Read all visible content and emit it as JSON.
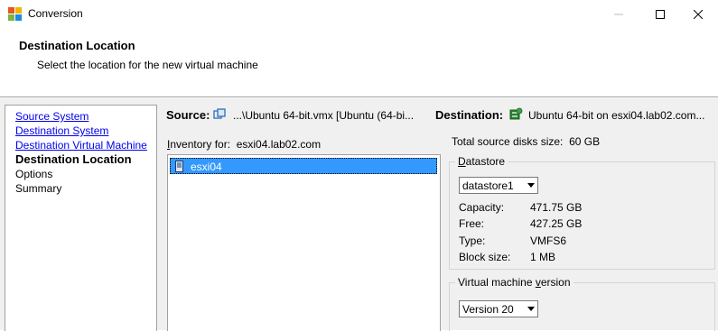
{
  "window": {
    "title": "Conversion"
  },
  "header": {
    "title": "Destination Location",
    "subtitle": "Select the location for the new virtual machine"
  },
  "nav": {
    "items": [
      {
        "label": "Source System",
        "state": "link"
      },
      {
        "label": "Destination System",
        "state": "link"
      },
      {
        "label": "Destination Virtual Machine",
        "state": "link"
      },
      {
        "label": "Destination Location",
        "state": "current"
      },
      {
        "label": "Options",
        "state": "plain"
      },
      {
        "label": "Summary",
        "state": "plain"
      }
    ]
  },
  "source": {
    "label": "Source:",
    "value": "...\\Ubuntu 64-bit.vmx [Ubuntu (64-bi..."
  },
  "destination": {
    "label": "Destination:",
    "value": "Ubuntu 64-bit on esxi04.lab02.com..."
  },
  "inventory": {
    "label_underlined": "I",
    "label_rest": "nventory for:",
    "host": "esxi04.lab02.com",
    "tree": [
      {
        "label": "esxi04",
        "selected": true
      }
    ]
  },
  "total_disk": {
    "label": "Total source disks size:",
    "value": "60 GB"
  },
  "datastore": {
    "legend_underlined": "D",
    "legend_rest": "atastore",
    "selected": "datastore1",
    "capacity_label": "Capacity:",
    "capacity": "471.75 GB",
    "free_label": "Free:",
    "free": "427.25 GB",
    "type_label": "Type:",
    "type": "VMFS6",
    "block_label": "Block size:",
    "block": "1 MB"
  },
  "vm_version": {
    "legend_pre": "Virtual machine ",
    "legend_underlined": "v",
    "legend_post": "ersion",
    "selected": "Version 20"
  },
  "icons": {
    "app": "vmware-converter-icon",
    "source": "vm-icon",
    "destination": "esxi-host-icon",
    "tree": "host-icon"
  },
  "colors": {
    "selection": "#3399ff",
    "link": "#0000ee",
    "panel_bg": "#f0f0f0"
  }
}
